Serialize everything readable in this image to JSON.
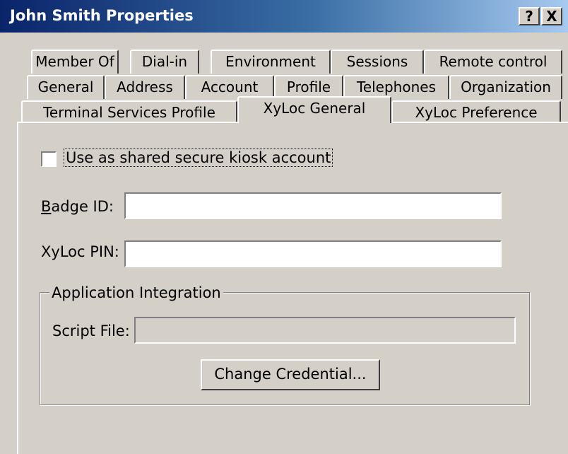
{
  "window": {
    "title": "John Smith Properties",
    "help_button": "?",
    "close_button": "X"
  },
  "tabs": {
    "row1": [
      "Member Of",
      "Dial-in",
      "Environment",
      "Sessions",
      "Remote control"
    ],
    "row2": [
      "General",
      "Address",
      "Account",
      "Profile",
      "Telephones",
      "Organization"
    ],
    "row3": [
      "Terminal Services Profile",
      "XyLoc General",
      "XyLoc Preference"
    ],
    "active": "XyLoc General"
  },
  "form": {
    "kiosk_checkbox": {
      "label": "Use as shared secure kiosk account",
      "checked": false
    },
    "badge_id": {
      "label_first": "B",
      "label_rest": "adge ID:",
      "value": ""
    },
    "pin": {
      "label": "XyLoc PIN:",
      "value": ""
    },
    "integration": {
      "title": "Application Integration",
      "script_label": "Script File:",
      "script_value": "",
      "button": "Change Credential..."
    }
  }
}
